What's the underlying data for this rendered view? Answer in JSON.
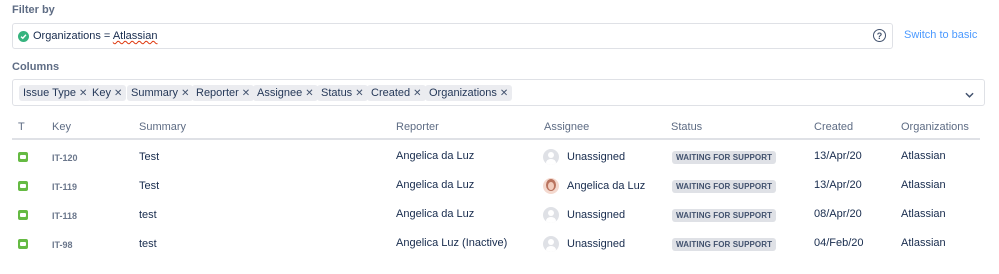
{
  "filter": {
    "label": "Filter by",
    "jql_prefix": "Organizations = ",
    "jql_value": "Atlassian",
    "switch_label": "Switch to basic",
    "help_glyph": "?"
  },
  "columns": {
    "label": "Columns",
    "chips": [
      "Issue Type",
      "Key",
      "Summary",
      "Reporter",
      "Assignee",
      "Status",
      "Created",
      "Organizations"
    ]
  },
  "table": {
    "headers": [
      "T",
      "Key",
      "Summary",
      "Reporter",
      "Assignee",
      "Status",
      "Created",
      "Organizations"
    ],
    "rows": [
      {
        "type": "service-request-icon",
        "key": "IT-120",
        "summary": "Test",
        "reporter": "Angelica da Luz",
        "assignee": "Unassigned",
        "assignee_avatar": "default-avatar-icon",
        "status": "WAITING FOR SUPPORT",
        "created": "13/Apr/20",
        "organization": "Atlassian"
      },
      {
        "type": "service-request-icon",
        "key": "IT-119",
        "summary": "Test",
        "reporter": "Angelica da Luz",
        "assignee": "Angelica da Luz",
        "assignee_avatar": "user-photo-avatar",
        "status": "WAITING FOR SUPPORT",
        "created": "13/Apr/20",
        "organization": "Atlassian"
      },
      {
        "type": "service-request-icon",
        "key": "IT-118",
        "summary": "test",
        "reporter": "Angelica da Luz",
        "assignee": "Unassigned",
        "assignee_avatar": "default-avatar-icon",
        "status": "WAITING FOR SUPPORT",
        "created": "08/Apr/20",
        "organization": "Atlassian"
      },
      {
        "type": "service-request-icon",
        "key": "IT-98",
        "summary": "test",
        "reporter": "Angelica Luz (Inactive)",
        "assignee": "Unassigned",
        "assignee_avatar": "default-avatar-icon",
        "status": "WAITING FOR SUPPORT",
        "created": "04/Feb/20",
        "organization": "Atlassian"
      }
    ]
  },
  "colors": {
    "accent_link": "#4C9AFF",
    "valid_check": "#36B37E",
    "issue_type": "#65BA43",
    "status_badge_bg": "#DFE1E6"
  }
}
